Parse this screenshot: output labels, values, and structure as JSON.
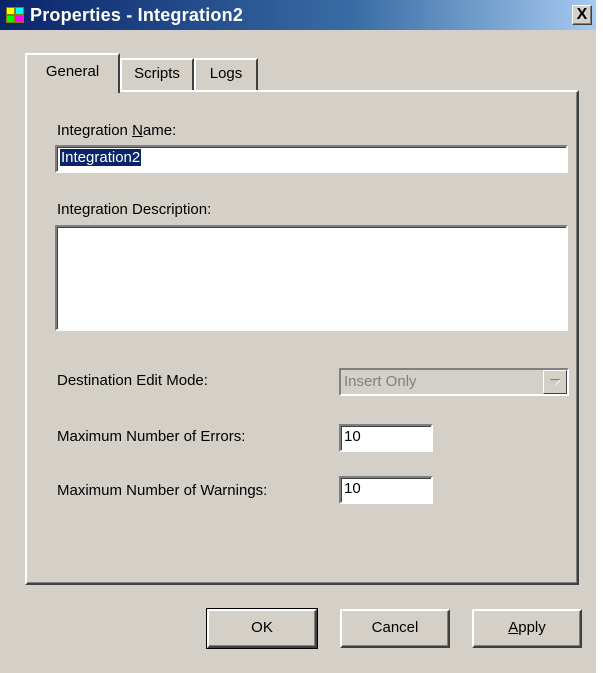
{
  "window": {
    "title": "Properties - Integration2",
    "close_label": "X"
  },
  "tabs": [
    {
      "label": "General",
      "active": true
    },
    {
      "label": "Scripts",
      "active": false
    },
    {
      "label": "Logs",
      "active": false
    }
  ],
  "form": {
    "name_label_prefix": "Integration ",
    "name_label_mnemonic": "N",
    "name_label_suffix": "ame:",
    "name_value": "Integration2",
    "description_label": "Integration Description:",
    "description_value": "",
    "edit_mode_label": "Destination Edit Mode:",
    "edit_mode_value": "Insert Only",
    "max_errors_label": "Maximum Number of Errors:",
    "max_errors_value": "10",
    "max_warnings_label": "Maximum Number of Warnings:",
    "max_warnings_value": "10"
  },
  "buttons": {
    "ok": "OK",
    "cancel": "Cancel",
    "apply_mnemonic": "A",
    "apply_rest": "pply"
  },
  "colors": {
    "titlebar_start": "#0a246a",
    "titlebar_end": "#a6caf0",
    "face": "#d4d0c8",
    "selection": "#0a246a"
  },
  "icons": {
    "app": "integration-icon",
    "dropdown": "chevron-down-icon"
  }
}
